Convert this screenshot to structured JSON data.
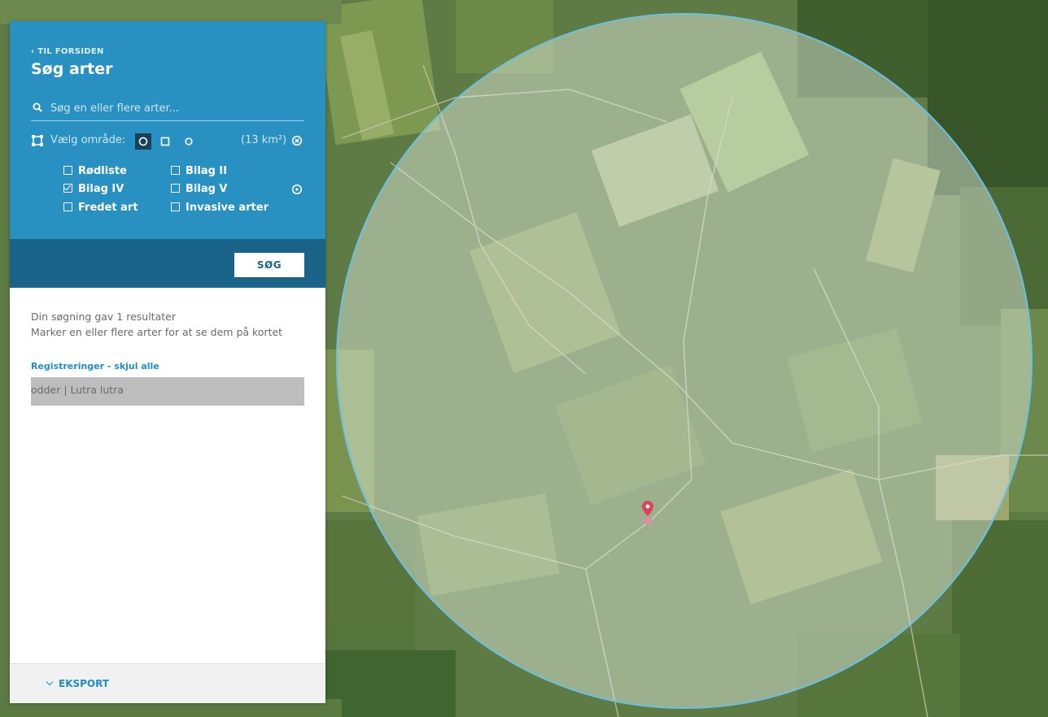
{
  "panel": {
    "back_link": "‹ TIL FORSIDEN",
    "title": "Søg arter",
    "search": {
      "value": "",
      "placeholder": "Søg en eller flere arter..."
    },
    "area": {
      "label": "Vælg område:",
      "selected_shape": "circle",
      "shapes": [
        "circle",
        "rectangle",
        "point"
      ],
      "size": "(13 km²)"
    },
    "filters": [
      {
        "label": "Rødliste",
        "checked": false
      },
      {
        "label": "Bilag II",
        "checked": false
      },
      {
        "label": "Bilag IV",
        "checked": true
      },
      {
        "label": "Bilag V",
        "checked": false
      },
      {
        "label": "Fredet art",
        "checked": false
      },
      {
        "label": "Invasive arter",
        "checked": false
      }
    ],
    "search_button": "SØG",
    "result_line1": "Din søgning gav 1 resultater",
    "result_line2": "Marker en eller flere arter for at se dem på kortet",
    "registreringer_link": "Registreringer - skjul alle",
    "results": [
      {
        "label": "odder | Lutra lutra"
      }
    ],
    "export_label": "EKSPORT"
  },
  "colors": {
    "panel_header": "#2891c1",
    "panel_band": "#1b6489",
    "link": "#1f8fc2",
    "search_area_fill": "#e8f1e6",
    "search_area_stroke": "#6cc0e0",
    "marker": "#e0435c"
  },
  "icons": [
    "search-icon",
    "area-select-icon",
    "circle-shape-icon",
    "rectangle-shape-icon",
    "point-shape-icon",
    "clear-area-icon",
    "play-circle-icon",
    "chevron-down-icon",
    "map-pin-icon"
  ]
}
